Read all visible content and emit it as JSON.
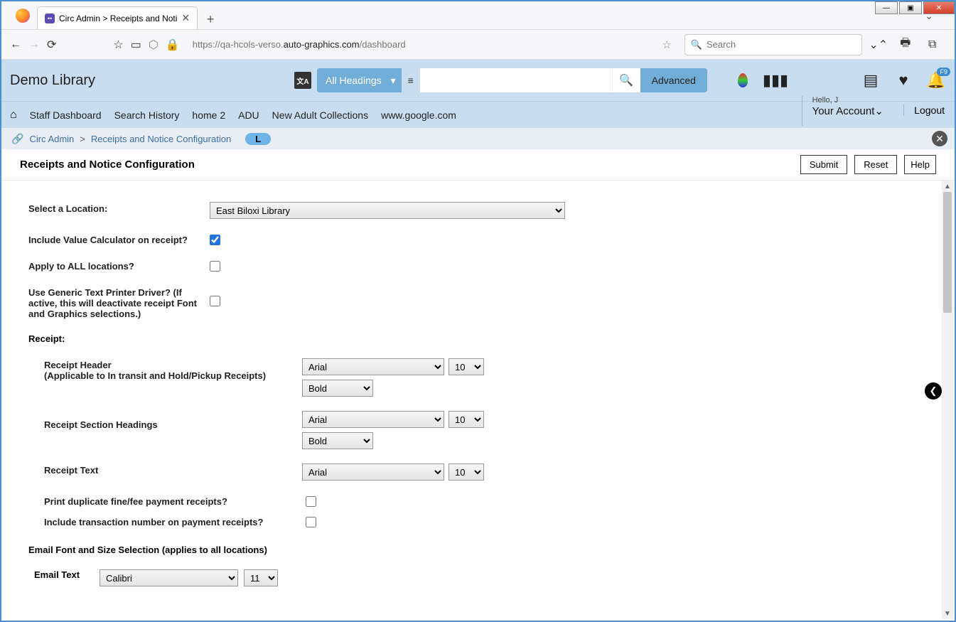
{
  "win": {
    "min": "—",
    "max": "▣",
    "close": "✕"
  },
  "browser": {
    "tab_title": "Circ Admin > Receipts and Noti",
    "url_pre": "https://qa-hcols-verso.",
    "url_dark": "auto-graphics.com",
    "url_post": "/dashboard",
    "search_placeholder": "Search"
  },
  "header": {
    "app_title": "Demo Library",
    "headings_label": "All Headings",
    "advanced_label": "Advanced",
    "bell_badge": "F9"
  },
  "secnav": {
    "links": [
      "Staff Dashboard",
      "Search History",
      "home 2",
      "ADU",
      "New Adult Collections",
      "www.google.com"
    ],
    "hello": "Hello, J",
    "account": "Your Account",
    "logout": "Logout"
  },
  "crumb": {
    "a": "Circ Admin",
    "sep": ">",
    "b": "Receipts and Notice Configuration",
    "badge": "L"
  },
  "page": {
    "title": "Receipts and Notice Configuration",
    "submit": "Submit",
    "reset": "Reset",
    "help": "Help"
  },
  "form": {
    "select_location_label": "Select a Location:",
    "location_value": "East Biloxi Library",
    "include_value_calc_label": "Include Value Calculator on receipt?",
    "apply_all_label": "Apply to ALL locations?",
    "generic_driver_label": "Use Generic Text Printer Driver? (If active, this will deactivate receipt Font and Graphics selections.)",
    "receipt_section": "Receipt:",
    "receipt_header_label": "Receipt Header",
    "receipt_header_sub": "(Applicable to In transit and Hold/Pickup Receipts)",
    "receipt_section_headings_label": "Receipt Section Headings",
    "receipt_text_label": "Receipt Text",
    "print_dup_label": "Print duplicate fine/fee payment receipts?",
    "include_txn_label": "Include transaction number on payment receipts?",
    "email_section": "Email Font and Size Selection (applies to all locations)",
    "email_text_label": "Email Text",
    "font_arial": "Arial",
    "size_10": "10",
    "weight_bold": "Bold",
    "font_calibri": "Calibri",
    "size_11": "11"
  }
}
